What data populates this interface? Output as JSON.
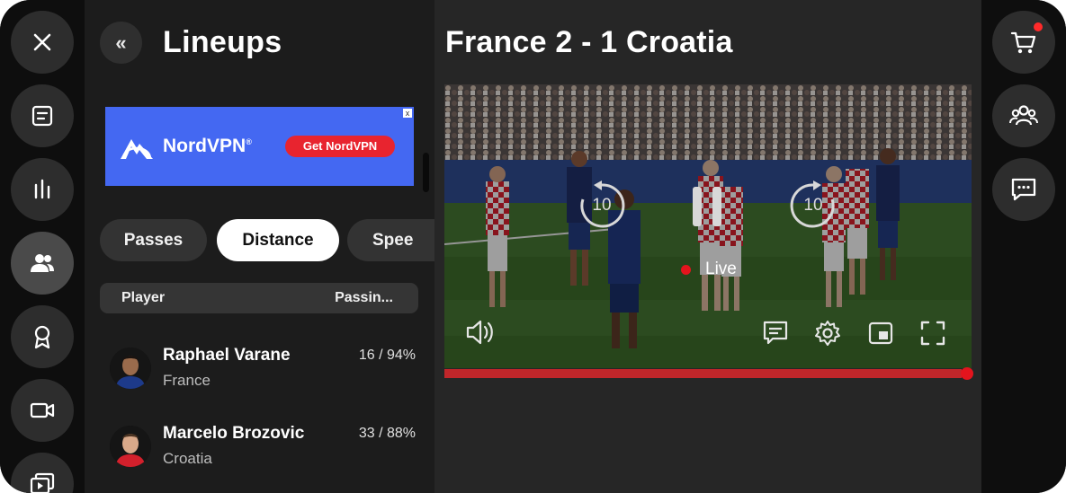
{
  "left_rail": {
    "items": [
      {
        "icon": "close-icon"
      },
      {
        "icon": "document-icon"
      },
      {
        "icon": "stats-bars-icon"
      },
      {
        "icon": "users-icon",
        "active": true
      },
      {
        "icon": "award-ribbon-icon"
      },
      {
        "icon": "video-camera-icon"
      },
      {
        "icon": "video-library-icon"
      }
    ]
  },
  "lineups": {
    "title": "Lineups",
    "back_icon": "double-chevron-left-icon",
    "ad": {
      "brand": "NordVPN",
      "trademark": "®",
      "cta": "Get NordVPN",
      "close": "x",
      "color": "#4468f2",
      "cta_color": "#e8242f"
    },
    "tabs": [
      {
        "label": "Passes",
        "selected": false
      },
      {
        "label": "Distance",
        "selected": true
      },
      {
        "label": "Spee",
        "selected": false
      }
    ],
    "table": {
      "columns": [
        "Player",
        "Passin..."
      ],
      "rows": [
        {
          "name": "Raphael Varane",
          "country": "France",
          "stat": "16 / 94%"
        },
        {
          "name": "Marcelo Brozovic",
          "country": "Croatia",
          "stat": "33 / 88%"
        }
      ]
    }
  },
  "video": {
    "match_title": "France 2 - 1 Croatia",
    "rewind_label": "10",
    "forward_label": "10",
    "live_label": "Live",
    "live_color": "#e3141d",
    "progress_fraction": 1.0,
    "controls": [
      "volume-icon",
      "subtitles-icon",
      "settings-gear-icon",
      "picture-in-picture-icon",
      "fullscreen-icon"
    ]
  },
  "right_rail": {
    "items": [
      {
        "icon": "shopping-cart-icon",
        "badge": true
      },
      {
        "icon": "group-icon"
      },
      {
        "icon": "chat-bubble-icon"
      }
    ]
  }
}
